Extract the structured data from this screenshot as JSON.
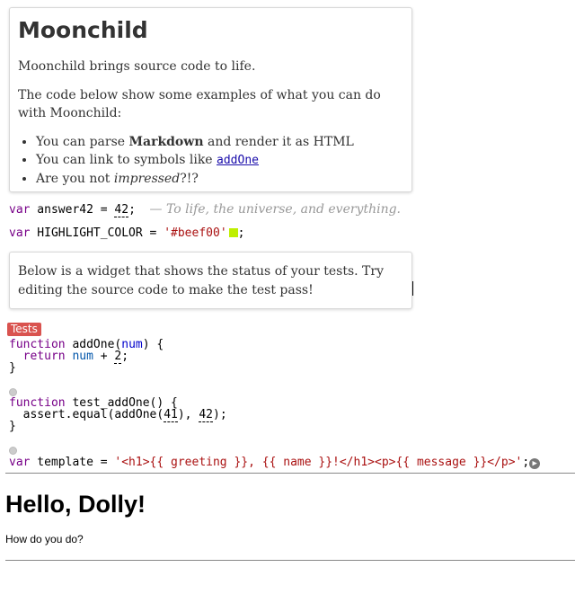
{
  "intro": {
    "title": "Moonchild",
    "p1": "Moonchild brings source code to life.",
    "p2": "The code below show some examples of what you can do with Moonchild:",
    "bullets": [
      {
        "before": "You can parse ",
        "bold": "Markdown",
        "after": " and render it as HTML"
      },
      {
        "before": "You can link to symbols like ",
        "link": "addOne"
      },
      {
        "before": "Are you not ",
        "italic": "impressed",
        "after": "?!?"
      }
    ]
  },
  "code": {
    "kw_var": "var",
    "answer_name": " answer42 = ",
    "answer_value": "42",
    "semicolon": ";",
    "answer_comment": "— To life, the universe, and everything.",
    "hl_name": " HIGHLIGHT_COLOR = ",
    "hl_value": "'#beef00'",
    "swatch_color": "#beef00",
    "kw_function": "function",
    "fn_addone_name": "addOne",
    "param_num": "num",
    "kw_return": "return",
    "add_value": "2",
    "fn_test_name": "test_addOne",
    "assert_call": "assert.equal(addOne(",
    "assert_arg": "41",
    "assert_expected": "42",
    "template_name": " template = ",
    "template_value": "'<h1>{{ greeting }}, {{ name }}!</h1><p>{{ message }}</p>'"
  },
  "widget": {
    "description": "Below is a widget that shows the status of your tests. Try editing the source code to make the test pass!",
    "status_badge": "Tests"
  },
  "output": {
    "title": "Hello, Dolly!",
    "message": "How do you do?"
  },
  "icons": {
    "run": "play-circle-icon",
    "gutter": "gutter-dot-icon"
  }
}
